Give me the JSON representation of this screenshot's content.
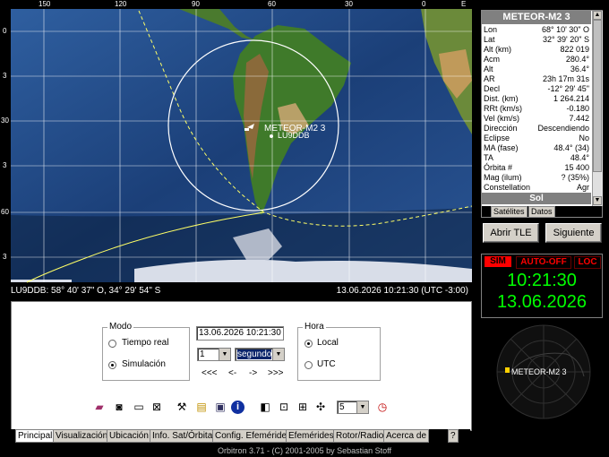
{
  "map": {
    "top_ticks": [
      "150",
      "120",
      "90",
      "60",
      "30",
      "0",
      "E"
    ],
    "left_ticks": [
      "0",
      "3",
      "30",
      "3",
      "60",
      "3"
    ],
    "satellite_label": "METEOR-M2 3",
    "station_label": "LU9DDB",
    "status_left": "LU9DDB: 58° 40' 37\" O, 34° 29' 54\" S",
    "status_right": "13.06.2026 10:21:30 (UTC -3:00)"
  },
  "info": {
    "title": "METEOR-M2 3",
    "rows": [
      {
        "k": "Lon",
        "v": "68° 10' 30\" O"
      },
      {
        "k": "Lat",
        "v": "32° 39' 20\" S"
      },
      {
        "k": "Alt (km)",
        "v": "822 019"
      },
      {
        "k": "Acm",
        "v": "280.4°"
      },
      {
        "k": "Alt",
        "v": "36.4°"
      },
      {
        "k": "AR",
        "v": "23h 17m 31s"
      },
      {
        "k": "Decl",
        "v": "-12° 29' 45\""
      },
      {
        "k": "Dist. (km)",
        "v": "1 264.214"
      },
      {
        "k": "RRt (km/s)",
        "v": "-0.180"
      },
      {
        "k": "Vel (km/s)",
        "v": "7.442"
      },
      {
        "k": "Dirección",
        "v": "Descendiendo"
      },
      {
        "k": "Eclipse",
        "v": "No"
      },
      {
        "k": "MA (fase)",
        "v": "48.4° (34)"
      },
      {
        "k": "TA",
        "v": "48.4°"
      },
      {
        "k": "Órbita #",
        "v": "15 400"
      },
      {
        "k": "Mag (ilum)",
        "v": "? (35%)"
      },
      {
        "k": "Constellation",
        "v": "Agr"
      }
    ],
    "sub_header": "Sol",
    "tab_sat": "Satélites",
    "tab_data": "Datos"
  },
  "buttons": {
    "open_tle": "Abrir TLE",
    "next": "Siguiente"
  },
  "clock": {
    "sim": "SIM",
    "auto": "AUTO-OFF",
    "loc": "LOC",
    "time": "10:21:30",
    "date": "13.06.2026"
  },
  "radar": {
    "label": "METEOR-M2 3"
  },
  "panel": {
    "modo_title": "Modo",
    "realtime": "Tiempo real",
    "simulation": "Simulación",
    "datetime": "13.06.2026 10:21:30",
    "step_value": "1",
    "step_unit": "segundo",
    "nav": [
      "<<<",
      "<-",
      "->",
      ">>>"
    ],
    "hora_title": "Hora",
    "local": "Local",
    "utc": "UTC",
    "speed_value": "5"
  },
  "tabs": [
    "Principal",
    "Visualización",
    "Ubicación",
    "Info. Sat/Órbita",
    "Config. Efemérides",
    "Efemérides",
    "Rotor/Radio",
    "Acerca de",
    "?"
  ],
  "status": "Orbitron 3.71 - (C) 2001-2005 by Sebastian Stoff",
  "colors": {
    "clock_green": "#00ff00",
    "alert_red": "#ff0000",
    "map_ocean": "#1b3f78"
  }
}
